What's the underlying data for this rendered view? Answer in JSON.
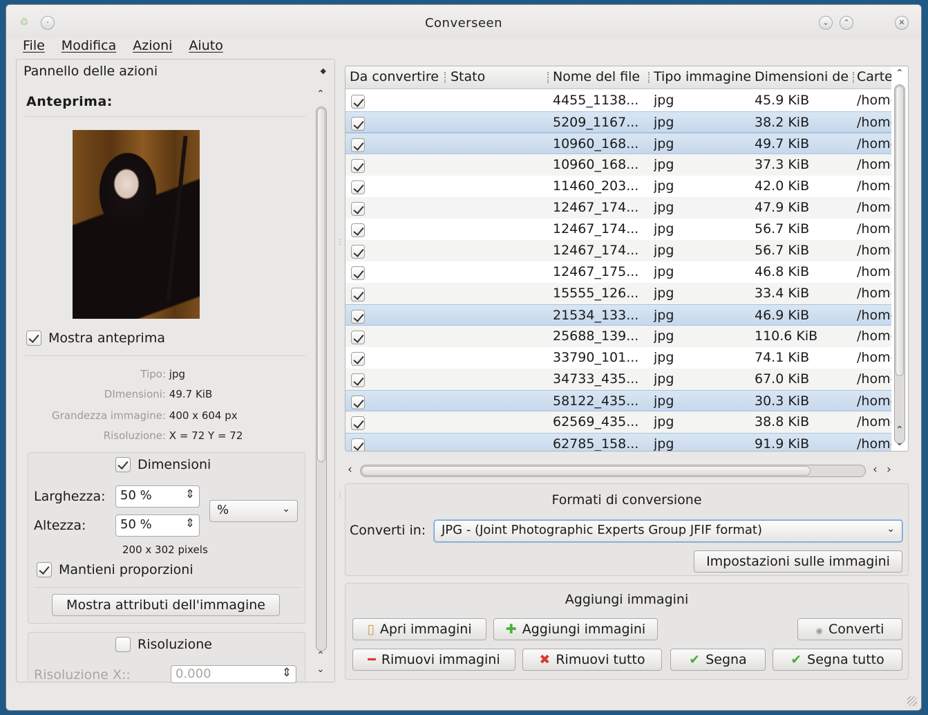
{
  "window": {
    "title": "Converseen"
  },
  "menu": [
    "File",
    "Modifica",
    "Azioni",
    "Aiuto"
  ],
  "actions_panel": {
    "title": "Pannello delle azioni",
    "preview_heading": "Anteprima:",
    "show_preview_label": "Mostra anteprima",
    "info": {
      "type_label": "Tipo:",
      "type_value": "jpg",
      "size_label": "DImensioni:",
      "size_value": "49.7 KiB",
      "dims_label": "Grandezza immagine:",
      "dims_value": "400 x 604 px",
      "res_label": "Risoluzione:",
      "res_value": "X = 72 Y = 72"
    },
    "dimensions": {
      "title": "Dimensioni",
      "width_label": "Larghezza:",
      "width_value": "50 %",
      "height_label": "Altezza:",
      "height_value": "50 %",
      "unit_value": "%",
      "pixels_text": "200 x 302 pixels",
      "keep_ratio_label": "Mantieni proporzioni",
      "show_attrs_button": "Mostra attributi dell'immagine"
    },
    "resolution": {
      "title": "Risoluzione",
      "x_label": "Risoluzione X::",
      "x_value": "0.000"
    }
  },
  "table": {
    "columns": [
      "Da convertire",
      "Stato",
      "Nome del file",
      "Tipo immagine",
      "Dimensioni de",
      "Carte"
    ],
    "rows": [
      {
        "name": "4455_1138...",
        "type": "jpg",
        "size": "45.9 KiB",
        "path": "/home",
        "selected": false
      },
      {
        "name": "5209_1167...",
        "type": "jpg",
        "size": "38.2 KiB",
        "path": "/home",
        "selected": true
      },
      {
        "name": "10960_168...",
        "type": "jpg",
        "size": "49.7 KiB",
        "path": "/home",
        "selected": true
      },
      {
        "name": "10960_168...",
        "type": "jpg",
        "size": "37.3 KiB",
        "path": "/home",
        "selected": false
      },
      {
        "name": "11460_203...",
        "type": "jpg",
        "size": "42.0 KiB",
        "path": "/home",
        "selected": false
      },
      {
        "name": "12467_174...",
        "type": "jpg",
        "size": "47.9 KiB",
        "path": "/home",
        "selected": false
      },
      {
        "name": "12467_174...",
        "type": "jpg",
        "size": "56.7 KiB",
        "path": "/home",
        "selected": false
      },
      {
        "name": "12467_174...",
        "type": "jpg",
        "size": "56.7 KiB",
        "path": "/home",
        "selected": false
      },
      {
        "name": "12467_175...",
        "type": "jpg",
        "size": "46.8 KiB",
        "path": "/home",
        "selected": false
      },
      {
        "name": "15555_126...",
        "type": "jpg",
        "size": "33.4 KiB",
        "path": "/home",
        "selected": false
      },
      {
        "name": "21534_133...",
        "type": "jpg",
        "size": "46.9 KiB",
        "path": "/home",
        "selected": true
      },
      {
        "name": "25688_139...",
        "type": "jpg",
        "size": "110.6 KiB",
        "path": "/home",
        "selected": false
      },
      {
        "name": "33790_101...",
        "type": "jpg",
        "size": "74.1 KiB",
        "path": "/home",
        "selected": false
      },
      {
        "name": "34733_435...",
        "type": "jpg",
        "size": "67.0 KiB",
        "path": "/home",
        "selected": false
      },
      {
        "name": "58122_435...",
        "type": "jpg",
        "size": "30.3 KiB",
        "path": "/home",
        "selected": true
      },
      {
        "name": "62569_435...",
        "type": "jpg",
        "size": "38.8 KiB",
        "path": "/home",
        "selected": false
      },
      {
        "name": "62785_158...",
        "type": "jpg",
        "size": "91.9 KiB",
        "path": "/home",
        "selected": true
      }
    ]
  },
  "formats": {
    "title": "Formati di conversione",
    "convert_label": "Converti in:",
    "convert_value": "JPG - (Joint Photographic Experts Group JFIF format)",
    "settings_button": "Impostazioni sulle immagini"
  },
  "add_images": {
    "title": "Aggiungi immagini",
    "open_button": "Apri immagini",
    "add_button": "Aggiungi immagini",
    "convert_button": "Converti",
    "remove_button": "Rimuovi immagini",
    "remove_all_button": "Rimuovi tutto",
    "mark_button": "Segna",
    "mark_all_button": "Segna tutto"
  },
  "colors": {
    "selection": "#c6d8ec",
    "desktop": "#1f5a86",
    "green_icon": "#4caf3a",
    "red_icon": "#d9392e"
  }
}
